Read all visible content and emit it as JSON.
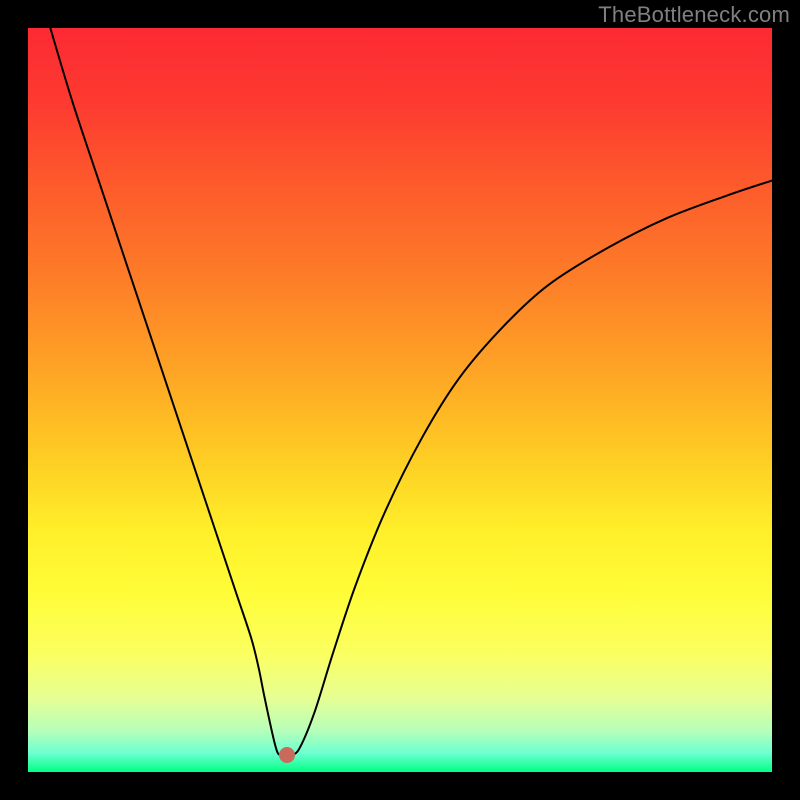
{
  "watermark": "TheBottleneck.com",
  "chart_data": {
    "type": "line",
    "title": "",
    "xlabel": "",
    "ylabel": "",
    "xlim": [
      0,
      100
    ],
    "ylim": [
      0,
      100
    ],
    "grid": false,
    "legend": false,
    "series": [
      {
        "name": "curve",
        "x": [
          3,
          6,
          10,
          14,
          18,
          22,
          26,
          28,
          30,
          31,
          31.8,
          33,
          33.6,
          34.3,
          35.4,
          36.5,
          38.5,
          41,
          44,
          48,
          53,
          58,
          64,
          70,
          78,
          86,
          94,
          100
        ],
        "y": [
          100,
          90,
          78,
          66,
          54,
          42,
          30,
          24,
          18,
          14,
          10,
          4.5,
          2.5,
          2.3,
          2.3,
          3.2,
          8,
          16,
          25,
          35,
          45,
          53,
          60,
          65.5,
          70.5,
          74.5,
          77.5,
          79.5
        ]
      }
    ],
    "marker": {
      "x": 34.8,
      "y": 2.3,
      "color": "#c96a5c"
    },
    "gradient_stops": [
      {
        "offset": 0,
        "color": "#fc2a33"
      },
      {
        "offset": 0.1,
        "color": "#fd3a30"
      },
      {
        "offset": 0.22,
        "color": "#fd5d2b"
      },
      {
        "offset": 0.34,
        "color": "#fd7e28"
      },
      {
        "offset": 0.46,
        "color": "#fea425"
      },
      {
        "offset": 0.58,
        "color": "#fece24"
      },
      {
        "offset": 0.68,
        "color": "#fff02a"
      },
      {
        "offset": 0.76,
        "color": "#fffd38"
      },
      {
        "offset": 0.84,
        "color": "#fbff60"
      },
      {
        "offset": 0.9,
        "color": "#e7ff93"
      },
      {
        "offset": 0.945,
        "color": "#b5ffba"
      },
      {
        "offset": 0.975,
        "color": "#6cffd1"
      },
      {
        "offset": 1.0,
        "color": "#00ff83"
      }
    ],
    "curve_color": "#000000",
    "curve_width": 2
  }
}
